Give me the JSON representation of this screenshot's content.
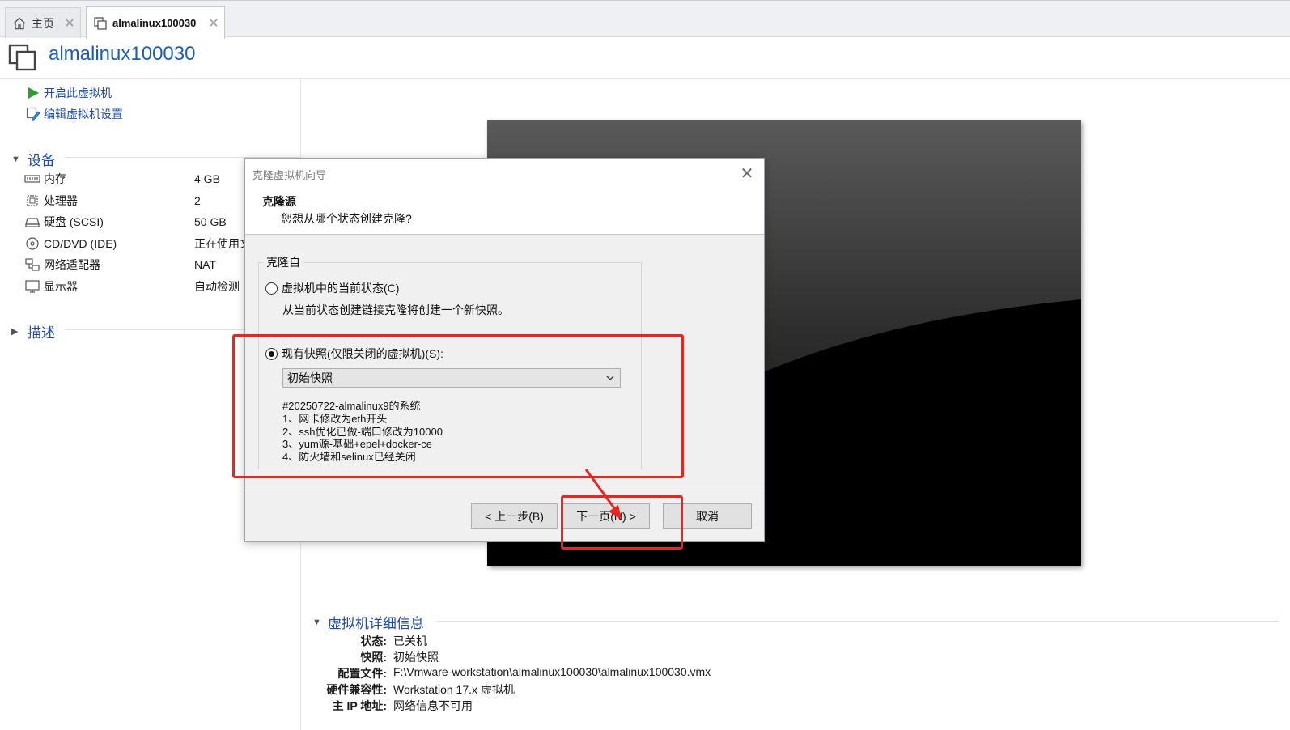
{
  "tabs": [
    {
      "label": "主页",
      "icon": "home-icon"
    },
    {
      "label": "almalinux100030",
      "icon": "vm-icon"
    }
  ],
  "title": "almalinux100030",
  "actions": {
    "power_on": "开启此虚拟机",
    "edit_settings": "编辑虚拟机设置"
  },
  "devices": {
    "heading": "设备",
    "items": [
      {
        "name": "内存",
        "value": "4 GB",
        "icon": "memory-icon"
      },
      {
        "name": "处理器",
        "value": "2",
        "icon": "cpu-icon"
      },
      {
        "name": "硬盘 (SCSI)",
        "value": "50 GB",
        "icon": "hard-disk-icon"
      },
      {
        "name": "CD/DVD (IDE)",
        "value": "正在使用文",
        "icon": "cd-dvd-icon"
      },
      {
        "name": "网络适配器",
        "value": "NAT",
        "icon": "network-icon"
      },
      {
        "name": "显示器",
        "value": "自动检测",
        "icon": "display-icon"
      }
    ]
  },
  "description": {
    "heading": "描述"
  },
  "vm_details": {
    "heading": "虚拟机详细信息",
    "rows": [
      {
        "key": "状态:",
        "value": "已关机"
      },
      {
        "key": "快照:",
        "value": "初始快照"
      },
      {
        "key": "配置文件:",
        "value": "F:\\Vmware-workstation\\almalinux100030\\almalinux100030.vmx"
      },
      {
        "key": "硬件兼容性:",
        "value": "Workstation 17.x 虚拟机"
      },
      {
        "key": "主 IP 地址:",
        "value": "网络信息不可用"
      }
    ]
  },
  "dialog": {
    "title": "克隆虚拟机向导",
    "header_title": "克隆源",
    "header_subtitle": "您想从哪个状态创建克隆?",
    "group_label": "克隆自",
    "option_current": "虚拟机中的当前状态(C)",
    "option_current_desc": "从当前状态创建链接克隆将创建一个新快照。",
    "option_current_selected": false,
    "option_snapshot": "现有快照(仅限关闭的虚拟机)(S):",
    "option_snapshot_selected": true,
    "snapshot_selected": "初始快照",
    "snapshot_description": [
      "#20250722-almalinux9的系统",
      "1、网卡修改为eth开头",
      "2、ssh优化已做-端口修改为10000",
      "3、yum源-基础+epel+docker-ce",
      "4、防火墙和selinux已经关闭"
    ],
    "buttons": {
      "back": "< 上一步(B)",
      "next": "下一页(N) >",
      "cancel": "取消"
    }
  },
  "colors": {
    "link": "#1d4aa8",
    "annotation": "#e8261f",
    "play_green": "#2e9e2e"
  }
}
